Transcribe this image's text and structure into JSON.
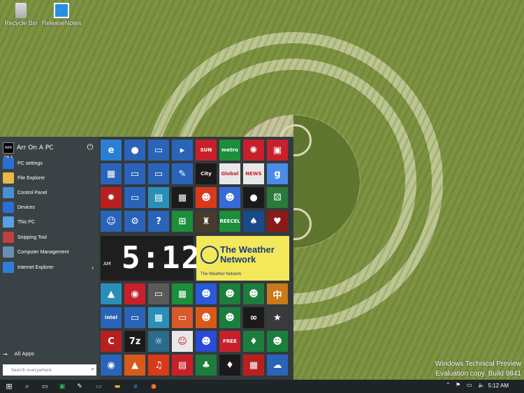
{
  "desktop": {
    "icons": [
      {
        "label": "Recycle Bin",
        "icon": "recycle-bin-icon"
      },
      {
        "label": "ReleaseNotes",
        "icon": "windows-logo-icon"
      }
    ],
    "watermark": {
      "line1": "Windows Technical Preview",
      "line2": "Evaluation copy. Build 9841"
    }
  },
  "start_menu": {
    "user": {
      "name": "Arr On A PC",
      "avatar_text": "ARR ON A PC"
    },
    "items": [
      {
        "label": "PC settings",
        "icon": "gear-icon",
        "color": "#2a6fd6"
      },
      {
        "label": "File Explorer",
        "icon": "folder-icon",
        "color": "#e8b84a"
      },
      {
        "label": "Control Panel",
        "icon": "control-panel-icon",
        "color": "#4a8fd4"
      },
      {
        "label": "Devices",
        "icon": "gear-icon",
        "color": "#2a6fd6"
      },
      {
        "label": "This PC",
        "icon": "computer-icon",
        "color": "#5aa0e0"
      },
      {
        "label": "Snipping Tool",
        "icon": "scissors-icon",
        "color": "#c04040"
      },
      {
        "label": "Computer Management",
        "icon": "computer-management-icon",
        "color": "#6b8eb0"
      },
      {
        "label": "Internet Explorer",
        "icon": "internet-explorer-icon",
        "color": "#2c7fd6"
      }
    ],
    "all_apps": "All Apps",
    "search_placeholder": "Search everywhere",
    "tiles_row1": [
      {
        "name": "internet-explorer-tile",
        "text": "e",
        "color": "#2a7fd4"
      },
      {
        "name": "firefox-tile",
        "text": "●",
        "color": "#2a64b8"
      },
      {
        "name": "remote-desktop-tile",
        "text": "▭",
        "color": "#2a64b8"
      },
      {
        "name": "powershell-tile",
        "text": "▸",
        "color": "#2a64b8"
      },
      {
        "name": "sun-news-tile",
        "text": "SUN",
        "color": "#c8202a"
      },
      {
        "name": "metro-tile",
        "text": "metro",
        "color": "#1c8e3c"
      },
      {
        "name": "cbc-tile",
        "text": "✺",
        "color": "#c8202a"
      },
      {
        "name": "video-tile",
        "text": "▣",
        "color": "#c8202a"
      }
    ],
    "tiles_row2": [
      {
        "name": "desktop-tile",
        "text": "▦",
        "color": "#2a64b8"
      },
      {
        "name": "display-tile",
        "text": "▭",
        "color": "#2a64b8"
      },
      {
        "name": "network-tile",
        "text": "▭",
        "color": "#2a64b8"
      },
      {
        "name": "paint-tile",
        "text": "✎",
        "color": "#2a64b8"
      },
      {
        "name": "city-tile",
        "text": "City",
        "color": "#1a1a1a"
      },
      {
        "name": "global-news-tile",
        "text": "Global",
        "color": "#e8e8e8"
      },
      {
        "name": "cbc-news-tile",
        "text": "NEWS",
        "color": "#e8e8e8"
      },
      {
        "name": "google-tile",
        "text": "g",
        "color": "#4a8ce8"
      }
    ],
    "tiles_row3": [
      {
        "name": "bug-tile",
        "text": "✹",
        "color": "#b82020"
      },
      {
        "name": "monitor-tile",
        "text": "▭",
        "color": "#2a64b8"
      },
      {
        "name": "notes-tile",
        "text": "▤",
        "color": "#2a8fb8"
      },
      {
        "name": "calculator-tile",
        "text": "▦",
        "color": "#1a1a1a"
      },
      {
        "name": "game1-tile",
        "text": "☻",
        "color": "#d83a1a"
      },
      {
        "name": "game2-tile",
        "text": "☻",
        "color": "#3a6ad8"
      },
      {
        "name": "backgammon-tile",
        "text": "●",
        "color": "#1a1a1a"
      },
      {
        "name": "dice-tile",
        "text": "⚄",
        "color": "#2a7a3a"
      }
    ],
    "tiles_row4": [
      {
        "name": "people-tile",
        "text": "☺",
        "color": "#2a64b8"
      },
      {
        "name": "settings-tile",
        "text": "⚙",
        "color": "#2a64b8"
      },
      {
        "name": "help-tile",
        "text": "?",
        "color": "#2a64b8"
      },
      {
        "name": "store-tile",
        "text": "⊞",
        "color": "#1c8e3c"
      },
      {
        "name": "chess-tile",
        "text": "♜",
        "color": "#4a3a2a"
      },
      {
        "name": "freecell-tile",
        "text": "FREECELL",
        "color": "#1c8e3c"
      },
      {
        "name": "solitaire-tile",
        "text": "♠",
        "color": "#1a4a8a"
      },
      {
        "name": "cards-tile",
        "text": "♥",
        "color": "#8a1a1a"
      }
    ],
    "clock": {
      "ampm": "AM",
      "time": "5:12"
    },
    "weather": {
      "title": "The Weather Network",
      "label": "The Weather Network"
    },
    "tiles_row5": [
      {
        "name": "photos-tile",
        "text": "▲",
        "color": "#2a8fb8"
      },
      {
        "name": "camera-tile",
        "text": "◉",
        "color": "#c8202a"
      },
      {
        "name": "gray-tile",
        "text": "▭",
        "color": "#5a5a5a"
      },
      {
        "name": "feed-tile",
        "text": "▦",
        "color": "#1c8e3c"
      },
      {
        "name": "minions-tile",
        "text": "☻",
        "color": "#2a5ad8"
      },
      {
        "name": "xbox-game-tile",
        "text": "☻",
        "color": "#1c7e3c"
      },
      {
        "name": "xbox-game2-tile",
        "text": "☻",
        "color": "#1c7e3c"
      },
      {
        "name": "mahjong-tile",
        "text": "中",
        "color": "#c87a1a"
      }
    ],
    "tiles_row6": [
      {
        "name": "intel-tile",
        "text": "intel",
        "color": "#2a64b8"
      },
      {
        "name": "disk-tile",
        "text": "▭",
        "color": "#2a64b8"
      },
      {
        "name": "apps-tile",
        "text": "▦",
        "color": "#2a8fb8"
      },
      {
        "name": "office-tile",
        "text": "▭",
        "color": "#d85a2a"
      },
      {
        "name": "game3-tile",
        "text": "☻",
        "color": "#d85a1a"
      },
      {
        "name": "game4-tile",
        "text": "☻",
        "color": "#1c7e3c"
      },
      {
        "name": "game5-tile",
        "text": "∞",
        "color": "#1a1a1a"
      },
      {
        "name": "game6-tile",
        "text": "★",
        "color": "#3a3a3a"
      }
    ],
    "tiles_row7": [
      {
        "name": "ccleaner-tile",
        "text": "C",
        "color": "#b82020"
      },
      {
        "name": "7zip-tile",
        "text": "7z",
        "color": "#1a1a1a"
      },
      {
        "name": "weather2-tile",
        "text": "☼",
        "color": "#2a6a8a"
      },
      {
        "name": "emoji-tile",
        "text": "☺",
        "color": "#e8e8e8"
      },
      {
        "name": "sonic-tile",
        "text": "☻",
        "color": "#2a4ad8"
      },
      {
        "name": "free-game-tile",
        "text": "FREE",
        "color": "#c8202a"
      },
      {
        "name": "space-game-tile",
        "text": "♦",
        "color": "#1c7e3c"
      },
      {
        "name": "game7-tile",
        "text": "☻",
        "color": "#1c7e3c"
      }
    ],
    "tiles_row8": [
      {
        "name": "eye-tile",
        "text": "◉",
        "color": "#2a64b8"
      },
      {
        "name": "vlc-tile",
        "text": "▲",
        "color": "#d85a1a"
      },
      {
        "name": "headphones-tile",
        "text": "♫",
        "color": "#d83a1a"
      },
      {
        "name": "news-tile",
        "text": "▤",
        "color": "#c8202a"
      },
      {
        "name": "solitaire2-tile",
        "text": "♣",
        "color": "#1c7e3c"
      },
      {
        "name": "game8-tile",
        "text": "♦",
        "color": "#1a1a1a"
      },
      {
        "name": "game9-tile",
        "text": "▦",
        "color": "#b82020"
      },
      {
        "name": "onedrive-tile",
        "text": "☁",
        "color": "#2a64b8"
      }
    ]
  },
  "taskbar": {
    "time": "5:12 AM",
    "items": [
      "start-button",
      "search-button",
      "task-view-button",
      "store-button",
      "tools-button",
      "remote-button",
      "explorer-button",
      "internet-explorer-button",
      "firefox-button"
    ]
  }
}
